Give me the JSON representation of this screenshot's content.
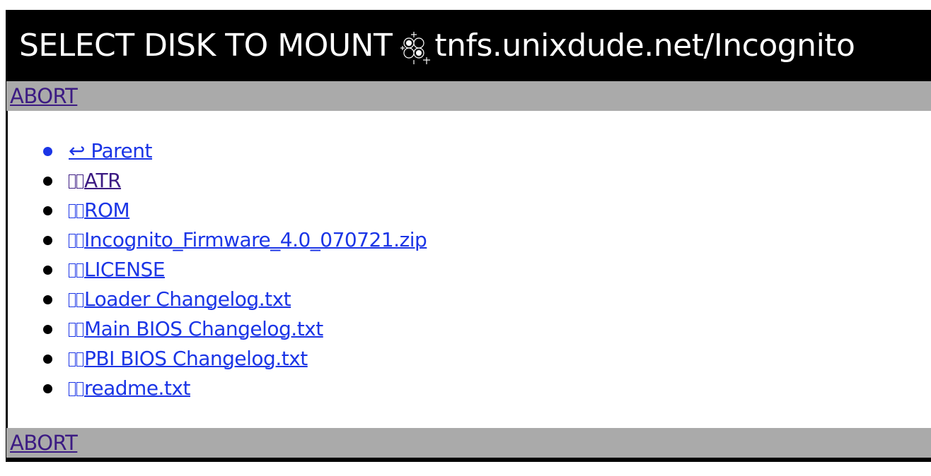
{
  "header": {
    "title_prefix": "SELECT DISK TO MOUNT",
    "icon": "tnfs-network-icon",
    "host_path": "tnfs.unixdude.net/Incognito"
  },
  "abort_label": "ABORT",
  "files": [
    {
      "label": "↩ Parent",
      "kind": "parent",
      "icon": ""
    },
    {
      "label": "ATR",
      "kind": "folder",
      "icon": "folder-icon"
    },
    {
      "label": "ROM",
      "kind": "folder",
      "icon": "folder-icon"
    },
    {
      "label": "Incognito_Firmware_4.0_070721.zip",
      "kind": "file",
      "icon": "file-icon"
    },
    {
      "label": "LICENSE",
      "kind": "file",
      "icon": "file-icon"
    },
    {
      "label": "Loader Changelog.txt",
      "kind": "file",
      "icon": "file-icon"
    },
    {
      "label": "Main BIOS Changelog.txt",
      "kind": "file",
      "icon": "file-icon"
    },
    {
      "label": "PBI BIOS Changelog.txt",
      "kind": "file",
      "icon": "file-icon"
    },
    {
      "label": "readme.txt",
      "kind": "file",
      "icon": "file-icon"
    }
  ],
  "colors": {
    "header_bg": "#000000",
    "bar_bg": "#aaaaaa",
    "link": "#1b35e6",
    "visited_link": "#3c1b83"
  }
}
